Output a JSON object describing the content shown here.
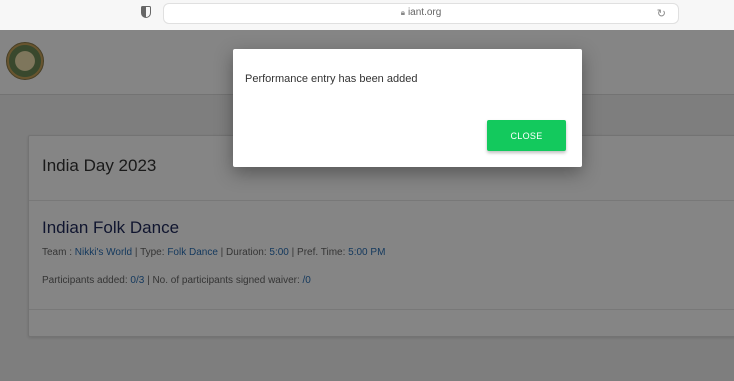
{
  "browser": {
    "url": "iant.org",
    "lock_icon": "lock-icon",
    "reload_icon": "reload-icon",
    "shield_icon": "shield-icon"
  },
  "event": {
    "title": "India Day 2023"
  },
  "performance": {
    "title": "Indian Folk Dance",
    "team_label": "Team : ",
    "team_value": "Nikki's World",
    "type_label": " | Type: ",
    "type_value": "Folk Dance",
    "duration_label": " | Duration: ",
    "duration_value": "5:00",
    "pref_time_label": " | Pref. Time: ",
    "pref_time_value": "5:00 PM",
    "participants_label": "Participants added: ",
    "participants_value": "0/3",
    "waiver_label": " | No. of participants signed waiver: ",
    "waiver_value": "/0"
  },
  "modal": {
    "message": "Performance entry has been added",
    "close_label": "CLOSE"
  },
  "colors": {
    "close_button": "#13c95d",
    "link": "#2a6fb5",
    "title": "#1f2a5a"
  }
}
